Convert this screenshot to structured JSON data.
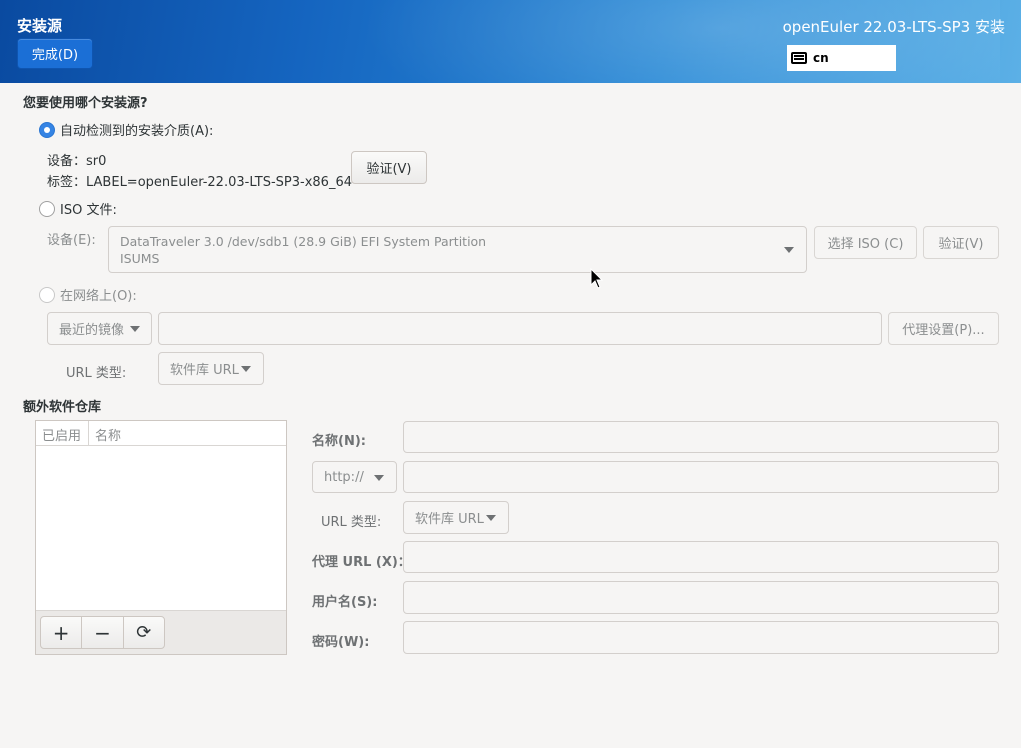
{
  "header": {
    "spoke_title": "安装源",
    "done_button": "完成(D)",
    "product_title": "openEuler 22.03-LTS-SP3 安装",
    "keyboard_layout": "cn"
  },
  "source": {
    "question": "您要使用哪个安装源?",
    "auto_detected_label": "自动检测到的安装介质(A):",
    "device_line": "设备：sr0",
    "label_line": "标签：LABEL=openEuler-22.03-LTS-SP3-x86_64",
    "verify_button": "验证(V)",
    "iso_label": "ISO 文件:",
    "iso_device_label": "设备(E):",
    "iso_device_value_line1": "DataTraveler 3.0 /dev/sdb1 (28.9 GiB) EFI System Partition",
    "iso_device_value_line2": "ISUMS",
    "choose_iso_button": "选择 ISO (C)",
    "iso_verify_button": "验证(V)",
    "network_label": "在网络上(O):",
    "mirror_combo": "最近的镜像",
    "proxy_button": "代理设置(P)...",
    "url_type_label": "URL 类型:",
    "url_type_value": "软件库 URL"
  },
  "repos": {
    "title": "额外软件仓库",
    "col_enabled": "已启用",
    "col_name": "名称",
    "add_icon": "+",
    "remove_icon": "−",
    "refresh_icon": "⟳",
    "name_label": "名称(N):",
    "protocol_value": "http://",
    "url_type_label": "URL 类型:",
    "url_type_value": "软件库 URL",
    "proxy_url_label": "代理 URL (X)：",
    "username_label": "用户名(S):",
    "password_label": "密码(W):"
  },
  "colors": {
    "accent": "#3584e4",
    "header_start": "#0a4aa0",
    "header_end": "#5cb0e6"
  }
}
